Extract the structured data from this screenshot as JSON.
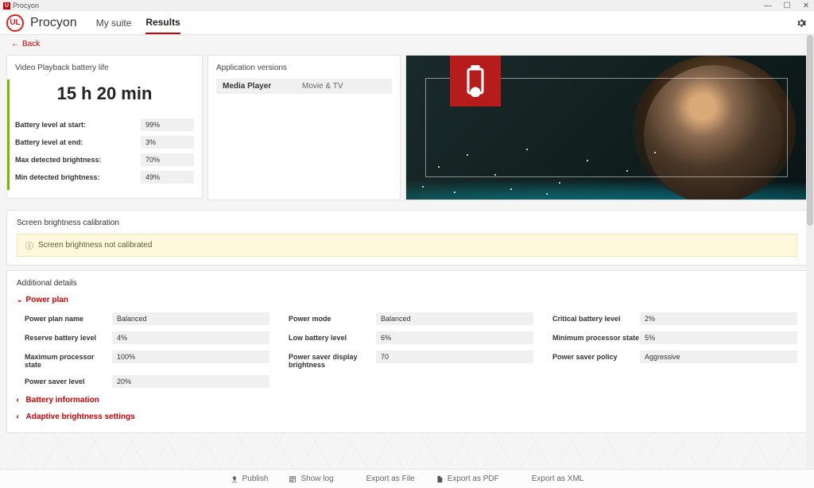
{
  "window": {
    "title": "Procyon"
  },
  "header": {
    "brand": "Procyon",
    "tabs": [
      {
        "label": "My suite",
        "active": false
      },
      {
        "label": "Results",
        "active": true
      }
    ]
  },
  "back": "Back",
  "score": {
    "title": "Video Playback battery life",
    "value": "15 h 20 min",
    "rows": [
      {
        "k": "Battery level at start:",
        "v": "99%"
      },
      {
        "k": "Battery level at end:",
        "v": "3%"
      },
      {
        "k": "Max detected brightness:",
        "v": "70%"
      },
      {
        "k": "Min detected brightness:",
        "v": "49%"
      }
    ]
  },
  "appver": {
    "title": "Application versions",
    "rows": [
      {
        "k": "Media Player",
        "v": "Movie & TV"
      }
    ]
  },
  "calibration": {
    "title": "Screen brightness calibration",
    "warning": "Screen brightness not calibrated"
  },
  "details": {
    "title": "Additional details",
    "sections": {
      "powerplan": {
        "label": "Power plan",
        "open": true,
        "cells": [
          {
            "k": "Power plan name",
            "v": "Balanced"
          },
          {
            "k": "Power mode",
            "v": "Balanced"
          },
          {
            "k": "Critical battery level",
            "v": "2%"
          },
          {
            "k": "Reserve battery level",
            "v": "4%"
          },
          {
            "k": "Low battery level",
            "v": "6%"
          },
          {
            "k": "Minimum processor state",
            "v": "5%"
          },
          {
            "k": "Maximum processor state",
            "v": "100%"
          },
          {
            "k": "Power saver display brightness",
            "v": "70"
          },
          {
            "k": "Power saver policy",
            "v": "Aggressive"
          },
          {
            "k": "Power saver level",
            "v": "20%"
          }
        ]
      },
      "battery": {
        "label": "Battery information",
        "open": false
      },
      "adaptive": {
        "label": "Adaptive brightness settings",
        "open": false
      }
    }
  },
  "footer": {
    "btns": [
      {
        "label": "Publish"
      },
      {
        "label": "Show log"
      },
      {
        "label": "Export as File"
      },
      {
        "label": "Export as PDF"
      },
      {
        "label": "Export as XML"
      }
    ]
  }
}
